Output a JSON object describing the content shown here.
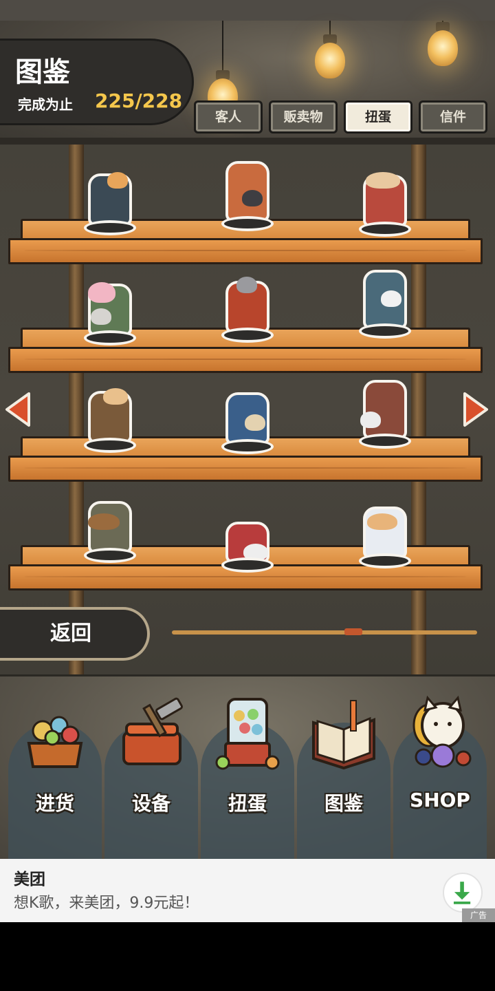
{
  "header": {
    "title": "图鉴",
    "progress_label": "完成为止",
    "progress_value": "225/228"
  },
  "tabs": [
    {
      "label": "客人",
      "active": false
    },
    {
      "label": "贩卖物",
      "active": false
    },
    {
      "label": "扭蛋",
      "active": true
    },
    {
      "label": "信件",
      "active": false
    }
  ],
  "collection": {
    "shelves": 4,
    "items_per_shelf": 3,
    "nav_left_icon": "left-arrow-icon",
    "nav_right_icon": "right-arrow-icon"
  },
  "back_button": {
    "label": "返回"
  },
  "page_scroll": {
    "position_fraction": 0.6
  },
  "bottom_nav": [
    {
      "label": "进货",
      "icon": "stock-crate-icon"
    },
    {
      "label": "设备",
      "icon": "toolbox-icon"
    },
    {
      "label": "扭蛋",
      "icon": "gacha-machine-icon"
    },
    {
      "label": "图鉴",
      "icon": "book-icon"
    },
    {
      "label": "SHOP",
      "icon": "lucky-cat-icon"
    }
  ],
  "ad": {
    "title": "美团",
    "description": "想K歌，来美团，9.9元起！",
    "tag": "广告",
    "download_icon": "download-icon"
  },
  "colors": {
    "accent_gold": "#f5c74c",
    "arrow_red": "#d9502b",
    "shelf_wood": "#e19347"
  }
}
